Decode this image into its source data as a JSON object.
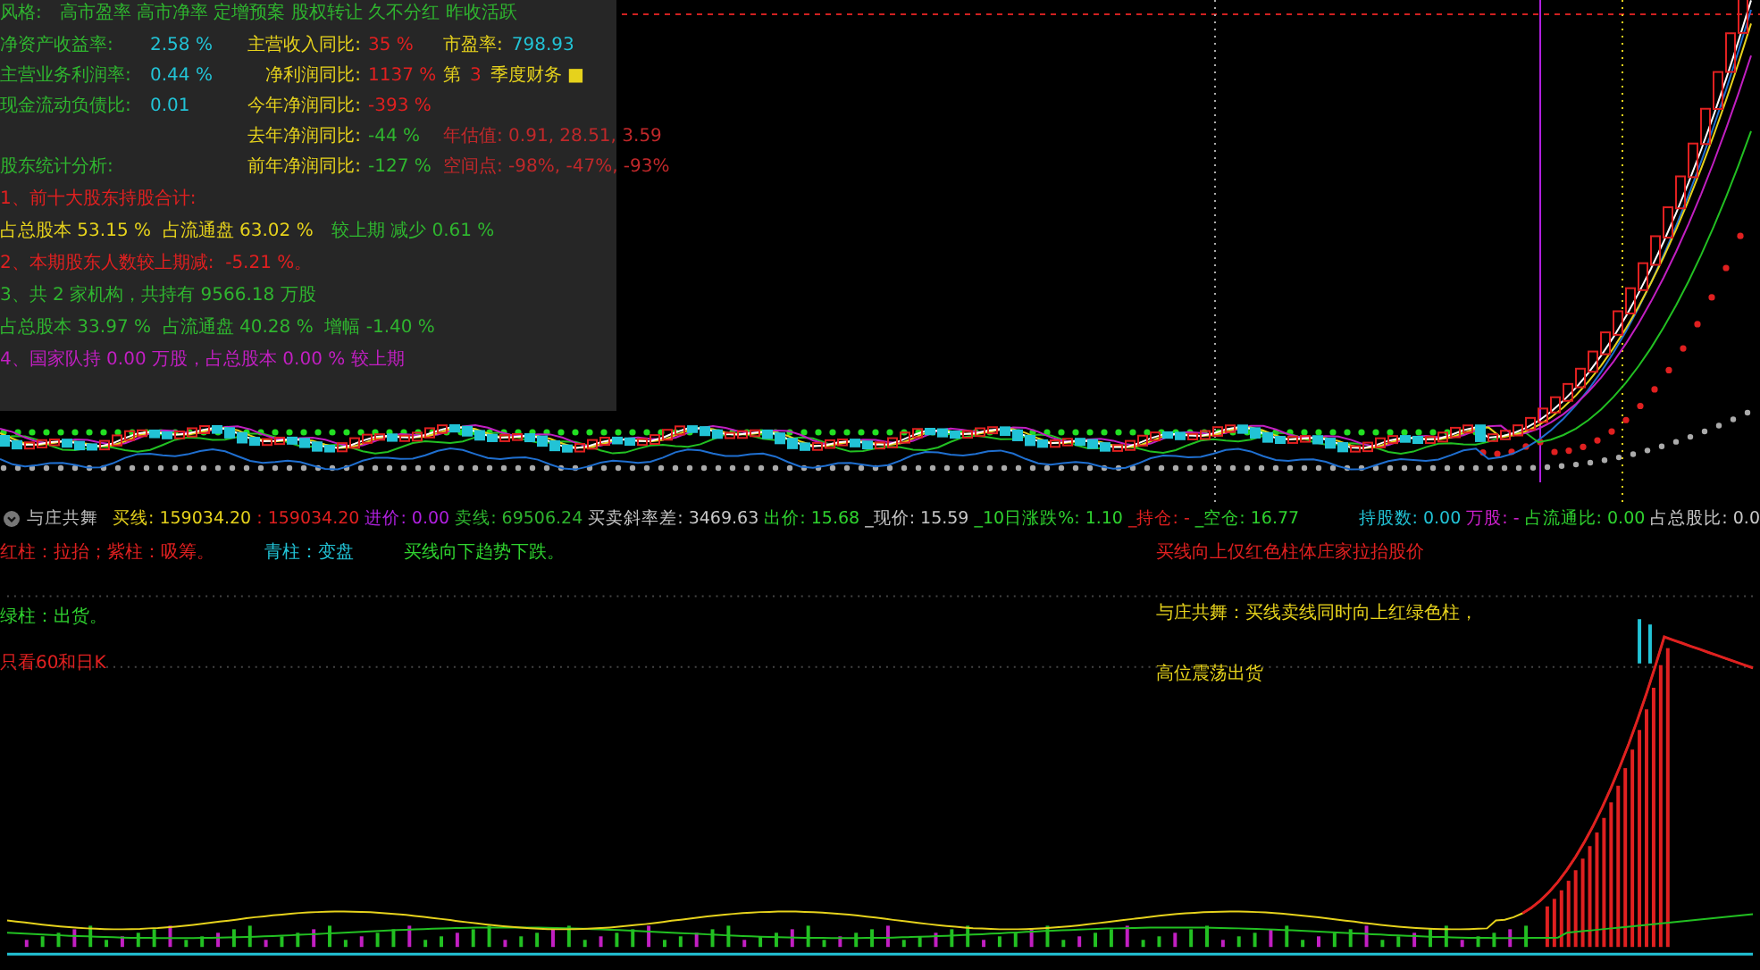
{
  "info_panel": {
    "style_line": {
      "label": "风格:",
      "tags": "高市盈率 高市净率 定增预案 股权转让 久不分红 昨收活跃"
    },
    "grid": [
      {
        "column_1": [
          {
            "text": "净资产收益率:",
            "color": "#2fb52f"
          }
        ],
        "column_2": [
          {
            "text": "2.58 %",
            "color": "#22c3d6"
          }
        ],
        "column_3": [
          {
            "text": "主营收入同比:",
            "color": "#e6d21c"
          }
        ],
        "column_4": [
          {
            "text": "35 %",
            "color": "#e02020"
          }
        ],
        "column_5": [
          {
            "text": "市盈率:",
            "color": "#e6d21c"
          },
          {
            "text": "798.93",
            "color": "#22c3d6"
          }
        ]
      },
      {
        "column_1": [
          {
            "text": "主营业务利润率:",
            "color": "#2fb52f"
          }
        ],
        "column_2": [
          {
            "text": "0.44 %",
            "color": "#22c3d6"
          }
        ],
        "column_3": [
          {
            "text": "净利润同比:",
            "color": "#e6d21c"
          }
        ],
        "column_4": [
          {
            "text": "1137 %",
            "color": "#e02020"
          }
        ],
        "column_5": [
          {
            "text": "第",
            "color": "#e6d21c"
          },
          {
            "text": "3",
            "color": "#e02020"
          },
          {
            "text": "季度财务 ■",
            "color": "#e6d21c"
          }
        ]
      },
      {
        "column_1": [
          {
            "text": "现金流动负债比:",
            "color": "#2fb52f"
          }
        ],
        "column_2": [
          {
            "text": "0.01",
            "color": "#22c3d6"
          }
        ],
        "column_3": [
          {
            "text": "今年净润同比:",
            "color": "#e6d21c"
          }
        ],
        "column_4": [
          {
            "text": "-393 %",
            "color": "#e02020"
          }
        ]
      },
      {
        "column_3": [
          {
            "text": "去年净润同比:",
            "color": "#e6d21c"
          }
        ],
        "column_4": [
          {
            "text": "-44 %",
            "color": "#2fb52f"
          }
        ],
        "column_5": [
          {
            "text": "年估值: 0.91, 28.51, 3.59",
            "color": "#c0282a"
          }
        ]
      },
      {
        "column_1": [
          {
            "text": "股东统计分析:",
            "color": "#2fb52f"
          }
        ],
        "column_3": [
          {
            "text": "前年净润同比:",
            "color": "#e6d21c"
          }
        ],
        "column_4": [
          {
            "text": "-127 %",
            "color": "#2fb52f"
          }
        ],
        "column_5": [
          {
            "text": "空间点: -98%, -47%, -93%",
            "color": "#c0282a"
          }
        ]
      }
    ],
    "lines": [
      [
        {
          "text": "1、前十大股东持股合计:",
          "color": "#e02020"
        }
      ],
      [
        {
          "text": "占总股本 53.15 %  占流通盘 63.02 %",
          "color": "#e6d21c"
        },
        {
          "text": "较上期 减少 0.61 %",
          "color": "#2fb52f"
        }
      ],
      [
        {
          "text": "2、本期股东人数较上期减:  -5.21 %。",
          "color": "#e02020"
        }
      ],
      [
        {
          "text": "3、共 2 家机构，共持有 9566.18 万股",
          "color": "#2fb52f"
        }
      ],
      [
        {
          "text": "占总股本 33.97 %  占流通盘 40.28 %  增幅 -1.40 %",
          "color": "#2fb52f"
        }
      ],
      [
        {
          "text": "4、国家队持 0.00 万股，占总股本 0.00 % 较上期",
          "color": "#c21fc2"
        }
      ]
    ]
  },
  "indicator_bar": {
    "title": "与庄共舞",
    "left_items": [
      {
        "text": "买线: 159034.20",
        "color": "#e6d21c"
      },
      {
        "text": ": 159034.20",
        "color": "#e02020"
      },
      {
        "text": "进价: 0.00",
        "color": "#b020e0"
      },
      {
        "text": "卖线: 69506.24",
        "color": "#2fb52f"
      },
      {
        "text": "买卖斜率差: 3469.63",
        "color": "#c8c8c8"
      },
      {
        "text": "出价: 15.68",
        "color": "#2fd22f"
      },
      {
        "text": "_现价: 15.59",
        "color": "#c8c8c8"
      },
      {
        "text": "_10日涨跌%: 1.10",
        "color": "#2fd22f"
      },
      {
        "text": "_持仓: -",
        "color": "#e02020"
      },
      {
        "text": "_空仓: 16.77",
        "color": "#2fd22f"
      }
    ],
    "right_items": [
      {
        "text": "持股数: 0.00",
        "color": "#22c3d6"
      },
      {
        "text": "万股: -",
        "color": "#d020d0"
      },
      {
        "text": "占流通比: 0.00",
        "color": "#2fd22f"
      },
      {
        "text": "占总股比: 0.0",
        "color": "#c8c8c8"
      }
    ]
  },
  "notes": {
    "left": [
      [
        {
          "text": "红柱：拉抬；紫柱：吸筹。",
          "color": "#e02020"
        },
        {
          "text": "青柱：变盘",
          "color": "#22c3d6"
        },
        {
          "text": "买线向下趋势下跌。",
          "color": "#2fd22f"
        }
      ],
      [
        {
          "text": "绿柱：出货。",
          "color": "#2fd22f"
        }
      ],
      [
        {
          "text": "只看60和日K",
          "color": "#e02020"
        }
      ]
    ],
    "right": [
      {
        "text": "买线向上仅红色柱体庄家拉抬股价",
        "color": "#e02020"
      },
      {
        "text": "与庄共舞：买线卖线同时向上红绿色柱，",
        "color": "#e6d21c"
      },
      {
        "text": "高位震荡出货",
        "color": "#e6d21c"
      }
    ]
  }
}
